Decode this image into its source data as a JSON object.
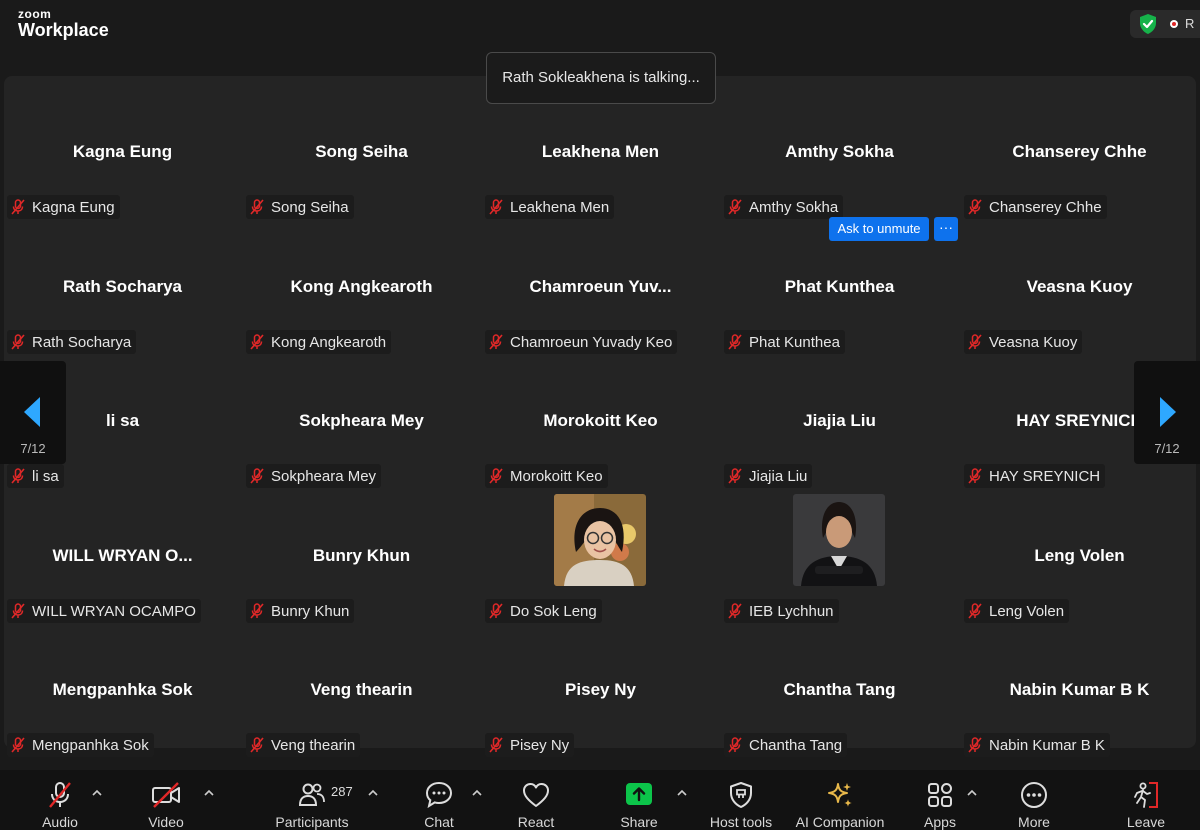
{
  "app": {
    "brand_top": "zoom",
    "brand_bottom": "Workplace",
    "record_text": "R"
  },
  "banner": {
    "talking": "Rath Sokleakhena is talking..."
  },
  "participants": [
    {
      "display": "Kagna Eung",
      "label": "Kagna Eung"
    },
    {
      "display": "Song Seiha",
      "label": "Song Seiha"
    },
    {
      "display": "Leakhena Men",
      "label": "Leakhena Men"
    },
    {
      "display": "Amthy Sokha",
      "label": "Amthy Sokha"
    },
    {
      "display": "Chanserey Chhe",
      "label": "Chanserey Chhe"
    },
    {
      "display": "Rath Socharya",
      "label": "Rath Socharya"
    },
    {
      "display": "Kong Angkearoth",
      "label": "Kong Angkearoth"
    },
    {
      "display": "Chamroeun  Yuv...",
      "label": "Chamroeun Yuvady Keo"
    },
    {
      "display": "Phat Kunthea",
      "label": "Phat Kunthea"
    },
    {
      "display": "Veasna Kuoy",
      "label": "Veasna Kuoy"
    },
    {
      "display": "li sa",
      "label": "li sa"
    },
    {
      "display": "Sokpheara Mey",
      "label": "Sokpheara Mey"
    },
    {
      "display": "Morokoitt Keo",
      "label": "Morokoitt Keo"
    },
    {
      "display": "Jiajia Liu",
      "label": "Jiajia Liu"
    },
    {
      "display": "HAY SREYNICH",
      "label": "HAY SREYNICH"
    },
    {
      "display": "WILL WRYAN O...",
      "label": "WILL WRYAN OCAMPO"
    },
    {
      "display": "Bunry Khun",
      "label": "Bunry Khun"
    },
    {
      "display": "",
      "label": "Do Sok Leng",
      "photo": "woman-glasses-photo"
    },
    {
      "display": "",
      "label": "IEB Lychhun",
      "photo": "woman-blazer-photo"
    },
    {
      "display": "Leng Volen",
      "label": "Leng Volen"
    },
    {
      "display": "Mengpanhka Sok",
      "label": "Mengpanhka Sok"
    },
    {
      "display": "Veng thearin",
      "label": "Veng thearin"
    },
    {
      "display": "Pisey Ny",
      "label": "Pisey Ny"
    },
    {
      "display": "Chantha Tang",
      "label": "Chantha Tang"
    },
    {
      "display": "Nabin Kumar B K",
      "label": "Nabin Kumar B K"
    }
  ],
  "hover_actions": {
    "ask_unmute": "Ask to unmute",
    "more": "···"
  },
  "pagination": {
    "left": "7/12",
    "right": "7/12"
  },
  "toolbar": {
    "audio": "Audio",
    "video": "Video",
    "participants": "Participants",
    "participants_count": "287",
    "chat": "Chat",
    "react": "React",
    "share": "Share",
    "host_tools": "Host tools",
    "ai_companion": "AI Companion",
    "apps": "Apps",
    "more": "More",
    "leave": "Leave"
  },
  "colors": {
    "accent_blue": "#0e72ed",
    "share_green": "#0cc44a",
    "muted_red": "#e02828",
    "nav_arrow": "#2ea8ff",
    "ai_gold": "#e8b84a"
  }
}
